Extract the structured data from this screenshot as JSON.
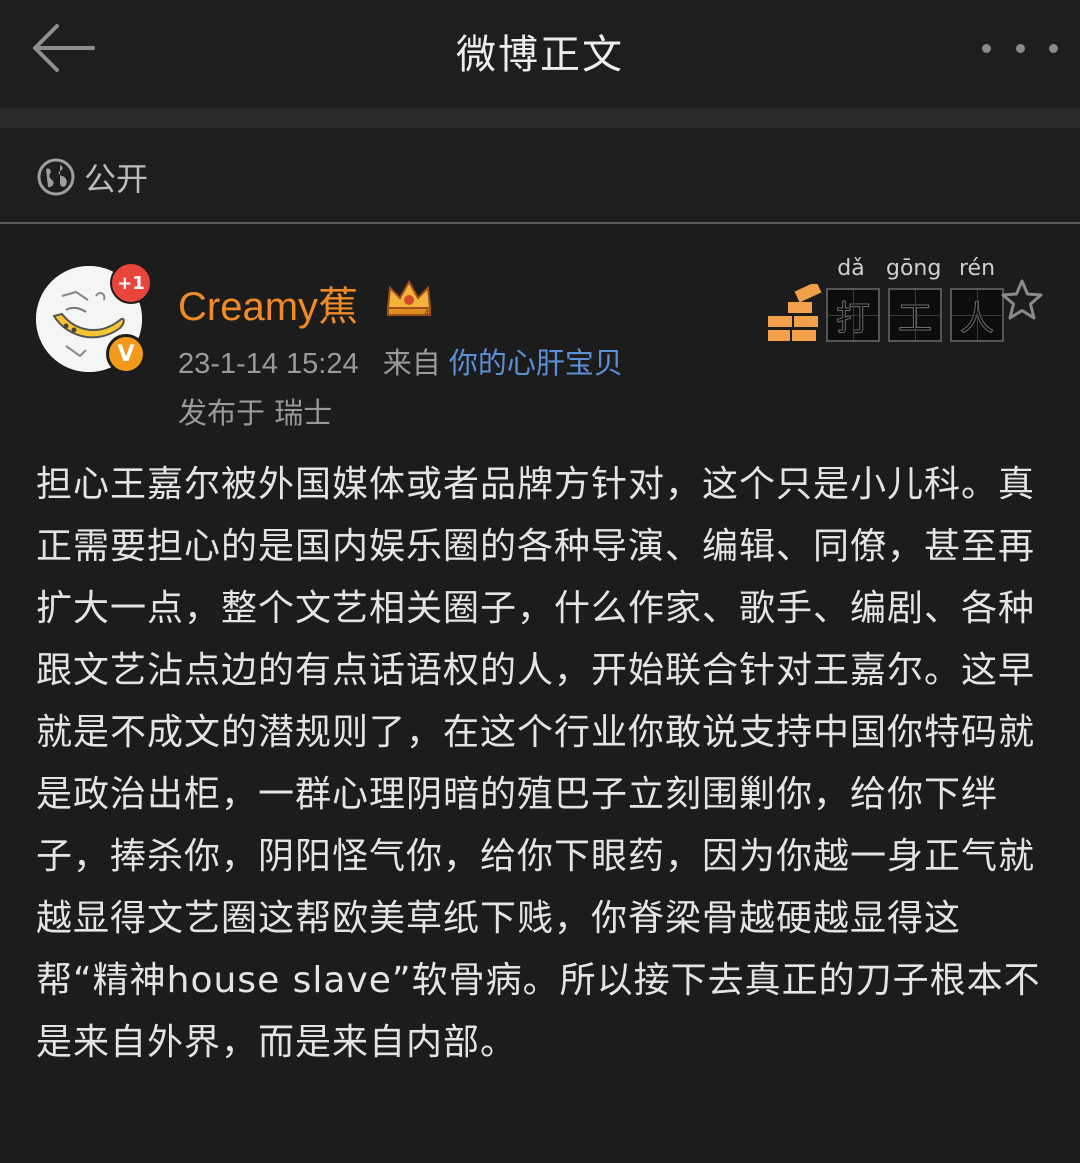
{
  "header": {
    "title": "微博正文"
  },
  "visibility": {
    "label": "公开"
  },
  "badge": {
    "pinyin": [
      "dǎ",
      "gōng",
      "rén"
    ],
    "chars": [
      "打",
      "工",
      "人"
    ]
  },
  "post": {
    "username": "Creamy蕉",
    "notification_count": "+1",
    "timestamp": "23-1-14 15:24",
    "source_prefix": "来自",
    "source_name": "你的心肝宝贝",
    "location": "发布于 瑞士",
    "body": "担心王嘉尔被外国媒体或者品牌方针对，这个只是小儿科。真正需要担心的是国内娱乐圈的各种导演、编辑、同僚，甚至再扩大一点，整个文艺相关圈子，什么作家、歌手、编剧、各种跟文艺沾点边的有点话语权的人，开始联合针对王嘉尔。这早就是不成文的潜规则了，在这个行业你敢说支持中国你特码就是政治出柜，一群心理阴暗的殖巴子立刻围剿你，给你下绊子，捧杀你，阴阳怪气你，给你下眼药，因为你越一身正气就越显得文艺圈这帮欧美草纸下贱，你脊梁骨越硬越显得这帮“精神house slave”软骨病。所以接下去真正的刀子根本不是来自外界，而是来自内部。"
  },
  "colors": {
    "background": "#1c1c1c",
    "username": "#f08a25",
    "link": "#5b8fd6",
    "meta": "#9a9a9a",
    "notification": "#e8453c",
    "verified": "#f39a1a"
  }
}
